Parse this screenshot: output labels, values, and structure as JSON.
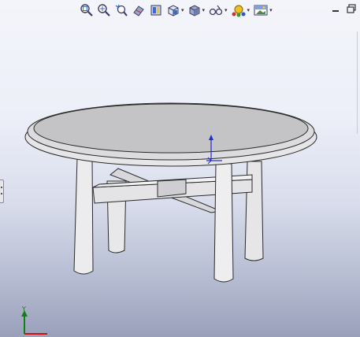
{
  "toolbar": {
    "items": [
      {
        "name": "zoom-to-fit-icon",
        "dropdown": false
      },
      {
        "name": "zoom-to-area-icon",
        "dropdown": false
      },
      {
        "name": "previous-view-icon",
        "dropdown": false
      },
      {
        "name": "section-view-icon",
        "dropdown": false
      },
      {
        "name": "dynamic-annotation-views-icon",
        "dropdown": false
      },
      {
        "name": "view-orientation-icon",
        "dropdown": true
      },
      {
        "name": "display-style-icon",
        "dropdown": true
      },
      {
        "name": "hide-show-items-icon",
        "dropdown": true
      },
      {
        "name": "edit-appearance-icon",
        "dropdown": true
      },
      {
        "name": "apply-scene-icon",
        "dropdown": true
      }
    ],
    "caret": "▾"
  },
  "window_controls": {
    "minimize_icon": "minimize-icon",
    "restore_icon": "restore-window-icon"
  },
  "triad": {
    "y_label": "Y",
    "colors": {
      "x": "#d01010",
      "y": "#108010",
      "z": "#1010d0"
    }
  },
  "colors": {
    "table_top": "#c4c4c6",
    "table_edge": "#e6e6e8",
    "leg": "#e8e8ea",
    "outline": "#2a2a2a",
    "origin_blue": "#2030d0"
  }
}
